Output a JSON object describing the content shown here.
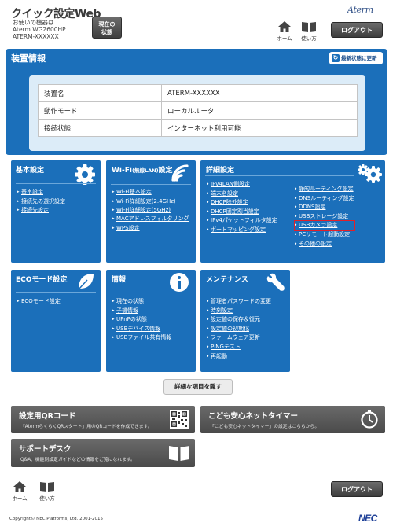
{
  "header": {
    "app_title": "クイック設定Web",
    "info_label": "お使いの機器は",
    "model": "Aterm WG2600HP",
    "device_name": "ATERM-XXXXXX",
    "status_button": "現在の\n状態",
    "brand_logo": "Aterm",
    "home_label": "ホーム",
    "manual_label": "使い方",
    "logout_label": "ログアウト"
  },
  "device_info": {
    "title": "装置情報",
    "refresh_label": "最新状態に更新",
    "rows": [
      {
        "key": "装置名",
        "value": "ATERM-XXXXXX"
      },
      {
        "key": "動作モード",
        "value": "ローカルルータ"
      },
      {
        "key": "接続状態",
        "value": "インターネット利用可能"
      }
    ]
  },
  "panels": {
    "basic": {
      "title": "基本設定",
      "icon": "gear-icon",
      "links": [
        "基本設定",
        "接続先の選択設定",
        "接続先設定"
      ]
    },
    "wifi": {
      "title_main": "Wi-Fi",
      "title_small": "(無線LAN)",
      "title_rest": "設定",
      "icon": "wifi-icon",
      "links": [
        "Wi-Fi基本設定",
        "Wi-Fi詳細設定(2.4GHz)",
        "Wi-Fi詳細設定(5GHz)",
        "MACアドレスフィルタリング",
        "WPS設定"
      ]
    },
    "advanced": {
      "title": "詳細設定",
      "icon": "gears-icon",
      "links_left": [
        "IPv4LAN側設定",
        "端末名設定",
        "DHCP除外設定",
        "DHCP固定割当設定",
        "IPv4パケットフィルタ設定",
        "ポートマッピング設定"
      ],
      "links_right": [
        "静的ルーティング設定",
        "DNSルーティング設定",
        "DDNS設定",
        "USBストレージ設定",
        "USBカメラ設定",
        "PCリモート起動設定",
        "その他の設定"
      ]
    },
    "eco": {
      "title": "ECOモード設定",
      "icon": "leaf-icon",
      "links": [
        "ECOモード設定"
      ]
    },
    "info": {
      "title": "情報",
      "icon": "info-icon",
      "links": [
        "現在の状態",
        "子機情報",
        "UPnPの状態",
        "USBデバイス情報",
        "USBファイル共有情報"
      ]
    },
    "maintenance": {
      "title": "メンテナンス",
      "icon": "wrench-icon",
      "links": [
        "管理者パスワードの変更",
        "時刻設定",
        "設定値の保存＆復元",
        "設定値の初期化",
        "ファームウェア更新",
        "PINGテスト",
        "再起動"
      ]
    }
  },
  "toggle_button": "詳細な項目を隠す",
  "banners": {
    "qr": {
      "title": "設定用QRコード",
      "desc": "「AtermらくらくQRスタート」用のQRコードを作成できます。"
    },
    "timer": {
      "title": "こども安心ネットタイマー",
      "desc": "「こども安心ネットタイマー」の設定はこちらから。"
    },
    "support": {
      "title": "サポートデスク",
      "desc": "Q&A、機能別設定ガイドなどの情報をご覧になれます。"
    }
  },
  "footer": {
    "home_label": "ホーム",
    "manual_label": "使い方",
    "logout_label": "ログアウト",
    "copyright": "Copyright© NEC Platforms, Ltd. 2001-2015",
    "brand": "NEC"
  },
  "highlighted_link": "USBカメラ設定"
}
